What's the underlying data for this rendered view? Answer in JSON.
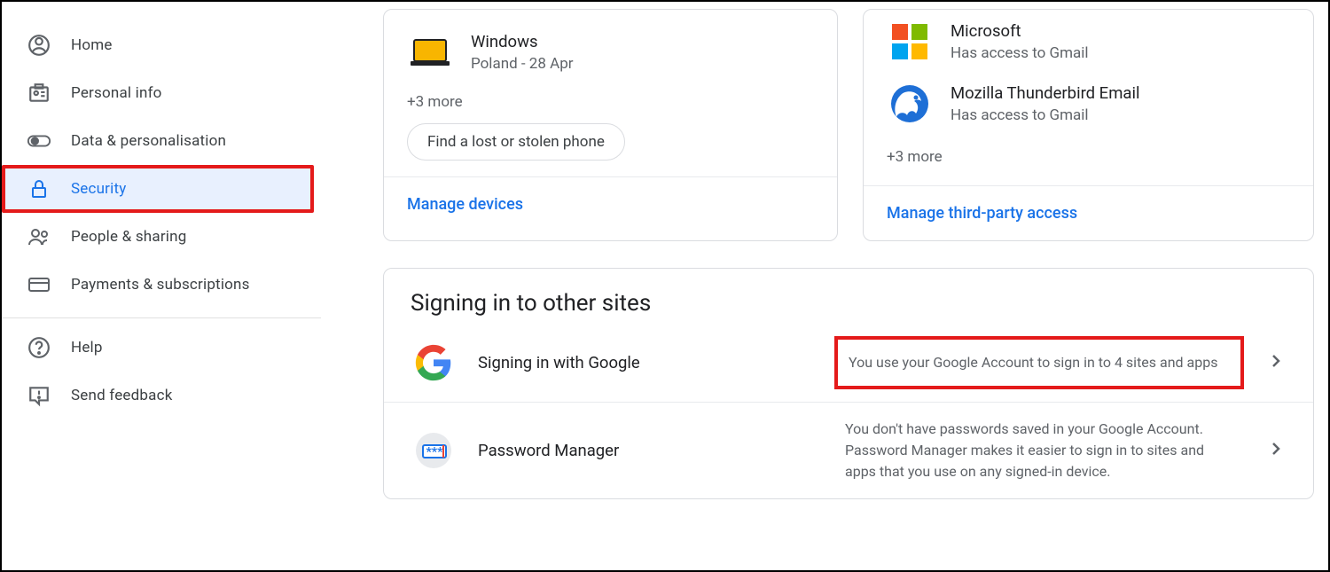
{
  "sidebar": {
    "items": [
      {
        "label": "Home",
        "icon": "home-icon"
      },
      {
        "label": "Personal info",
        "icon": "badge-icon"
      },
      {
        "label": "Data & personalisation",
        "icon": "toggle-icon"
      },
      {
        "label": "Security",
        "icon": "lock-icon"
      },
      {
        "label": "People & sharing",
        "icon": "people-icon"
      },
      {
        "label": "Payments & subscriptions",
        "icon": "card-icon"
      },
      {
        "label": "Help",
        "icon": "help-icon"
      },
      {
        "label": "Send feedback",
        "icon": "feedback-icon"
      }
    ]
  },
  "devices_card": {
    "device": {
      "name": "Windows",
      "subtitle": "Poland - 28 Apr"
    },
    "more_text": "+3 more",
    "find_phone_label": "Find a lost or stolen phone",
    "manage_label": "Manage devices"
  },
  "apps_card": {
    "apps": [
      {
        "name": "Microsoft",
        "access": "Has access to Gmail"
      },
      {
        "name": "Mozilla Thunderbird Email",
        "access": "Has access to Gmail"
      }
    ],
    "more_text": "+3 more",
    "manage_label": "Manage third-party access"
  },
  "signin_section": {
    "title": "Signing in to other sites",
    "rows": [
      {
        "label": "Signing in with Google",
        "desc": "You use your Google Account to sign in to 4 sites and apps"
      },
      {
        "label": "Password Manager",
        "desc": "You don't have passwords saved in your Google Account. Password Manager makes it easier to sign in to sites and apps that you use on any signed-in device."
      }
    ]
  }
}
